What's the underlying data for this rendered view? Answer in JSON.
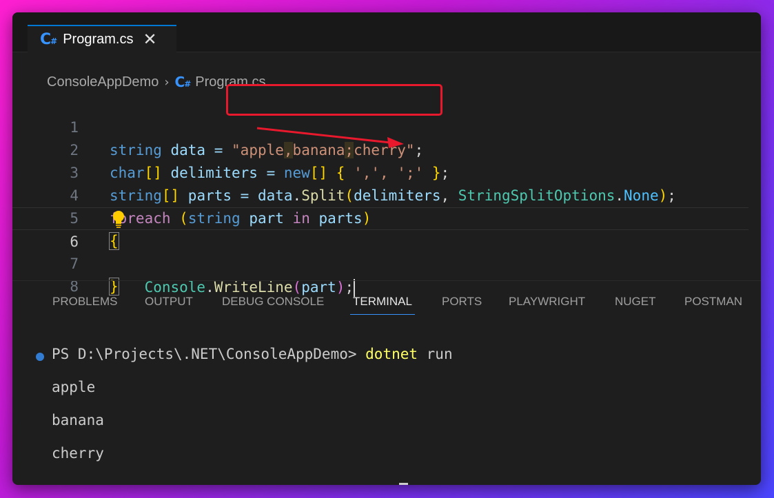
{
  "tab": {
    "label": "Program.cs",
    "close": "✕"
  },
  "breadcrumb": {
    "project": "ConsoleAppDemo",
    "file": "Program.cs"
  },
  "editor": {
    "line_numbers": [
      "1",
      "2",
      "3",
      "4",
      "5",
      "6",
      "7",
      "8"
    ],
    "l1": {
      "kw": "string",
      "name": " data = ",
      "q1": "\"",
      "w1": "apple",
      "c1": ",",
      "w2": "banana",
      "c2": ";",
      "w3": "cherry",
      "q2": "\"",
      "end": ";"
    },
    "l2": {
      "kw": "char",
      "br1": "[]",
      "name": " delimiters = ",
      "new": "new",
      "br2": "[]",
      "sp": " ",
      "ob": "{",
      "items": " ',', ';' ",
      "cb": "}",
      "end": ";"
    },
    "l3": {
      "kw": "string",
      "br1": "[]",
      "name": " parts = ",
      "obj": "data",
      "dot": ".",
      "fn": "Split",
      "op": "(",
      "arg": "delimiters",
      "comma": ", ",
      "enum": "StringSplitOptions",
      "dot2": ".",
      "member": "None",
      "cp": ")",
      "end": ";"
    },
    "l4": {
      "kw": "foreach",
      "sp": " ",
      "op": "(",
      "type": "string",
      "v1": " part ",
      "in": "in",
      "v2": " parts",
      "cp": ")"
    },
    "l5": {
      "brace": "{"
    },
    "l6": {
      "cls": "Console",
      "dot": ".",
      "fn": "WriteLine",
      "op": "(",
      "arg": "part",
      "cp": ")",
      "end": ";"
    },
    "l7": {
      "brace": "}"
    }
  },
  "panel": {
    "tabs": [
      "PROBLEMS",
      "OUTPUT",
      "DEBUG CONSOLE",
      "TERMINAL",
      "PORTS",
      "PLAYWRIGHT",
      "NUGET",
      "POSTMAN"
    ],
    "active": "TERMINAL"
  },
  "terminal": {
    "prompt": "PS D:\\Projects\\.NET\\ConsoleAppDemo> ",
    "command": "dotnet",
    "args": " run",
    "output": [
      "apple",
      "banana",
      "cherry"
    ]
  },
  "colors": {
    "accent": "#0078d4",
    "highlight_box": "#e8192c",
    "arrow": "#e8192c"
  }
}
